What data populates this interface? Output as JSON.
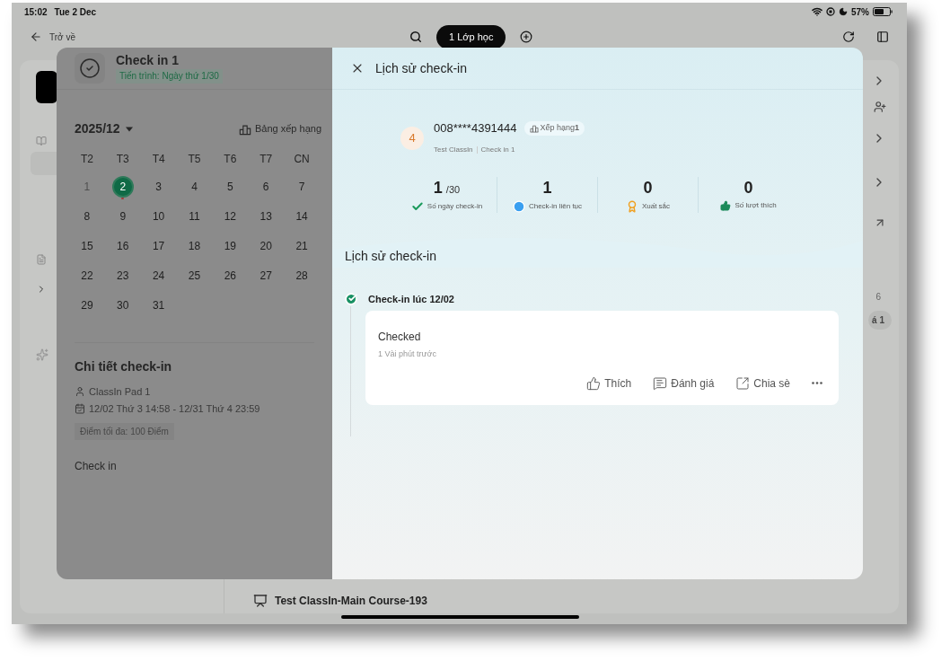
{
  "status_bar": {
    "time": "15:02",
    "date": "Tue 2 Dec",
    "battery": "57%"
  },
  "nav": {
    "back": "Trở về",
    "class_pill": "1 Lớp học"
  },
  "background": {
    "count": "6",
    "badge": "á 1",
    "course_title": "Test ClassIn-Main Course-193"
  },
  "checkin_panel": {
    "title": "Check in 1",
    "progress": "Tiến trình: Ngày thứ 1/30",
    "month": "2025/12",
    "ranking_link": "Bảng xếp hạng",
    "weekdays": [
      "T2",
      "T3",
      "T4",
      "T5",
      "T6",
      "T7",
      "CN"
    ],
    "days": [
      {
        "label": "1",
        "selected": false,
        "disabled": true,
        "marked": false
      },
      {
        "label": "2",
        "selected": true,
        "disabled": false,
        "marked": true
      },
      {
        "label": "3",
        "selected": false,
        "disabled": false,
        "marked": false
      },
      {
        "label": "4",
        "selected": false,
        "disabled": false,
        "marked": false
      },
      {
        "label": "5",
        "selected": false,
        "disabled": false,
        "marked": false
      },
      {
        "label": "6",
        "selected": false,
        "disabled": false,
        "marked": false
      },
      {
        "label": "7",
        "selected": false,
        "disabled": false,
        "marked": false
      },
      {
        "label": "8",
        "selected": false,
        "disabled": false,
        "marked": false
      },
      {
        "label": "9",
        "selected": false,
        "disabled": false,
        "marked": false
      },
      {
        "label": "10",
        "selected": false,
        "disabled": false,
        "marked": false
      },
      {
        "label": "11",
        "selected": false,
        "disabled": false,
        "marked": false
      },
      {
        "label": "12",
        "selected": false,
        "disabled": false,
        "marked": false
      },
      {
        "label": "13",
        "selected": false,
        "disabled": false,
        "marked": false
      },
      {
        "label": "14",
        "selected": false,
        "disabled": false,
        "marked": false
      },
      {
        "label": "15",
        "selected": false,
        "disabled": false,
        "marked": false
      },
      {
        "label": "16",
        "selected": false,
        "disabled": false,
        "marked": false
      },
      {
        "label": "17",
        "selected": false,
        "disabled": false,
        "marked": false
      },
      {
        "label": "18",
        "selected": false,
        "disabled": false,
        "marked": false
      },
      {
        "label": "19",
        "selected": false,
        "disabled": false,
        "marked": false
      },
      {
        "label": "20",
        "selected": false,
        "disabled": false,
        "marked": false
      },
      {
        "label": "21",
        "selected": false,
        "disabled": false,
        "marked": false
      },
      {
        "label": "22",
        "selected": false,
        "disabled": false,
        "marked": false
      },
      {
        "label": "23",
        "selected": false,
        "disabled": false,
        "marked": false
      },
      {
        "label": "24",
        "selected": false,
        "disabled": false,
        "marked": false
      },
      {
        "label": "25",
        "selected": false,
        "disabled": false,
        "marked": false
      },
      {
        "label": "26",
        "selected": false,
        "disabled": false,
        "marked": false
      },
      {
        "label": "27",
        "selected": false,
        "disabled": false,
        "marked": false
      },
      {
        "label": "28",
        "selected": false,
        "disabled": false,
        "marked": false
      },
      {
        "label": "29",
        "selected": false,
        "disabled": false,
        "marked": false
      },
      {
        "label": "30",
        "selected": false,
        "disabled": false,
        "marked": false
      },
      {
        "label": "31",
        "selected": false,
        "disabled": false,
        "marked": false
      }
    ],
    "details": {
      "heading": "Chi tiết check-in",
      "owner": "ClassIn Pad 1",
      "period": "12/02 Thứ 3 14:58 - 12/31 Thứ 4 23:59",
      "max_score": "Điểm tối đa: 100 Điểm",
      "description": "Check in"
    }
  },
  "history": {
    "title": "Lịch sử check-in",
    "user": {
      "avatar": "4",
      "name": "008****4391444",
      "rank": "Xếp hạng**1**",
      "class": "Test ClassIn",
      "activity": "Check in 1"
    },
    "stats": [
      {
        "kind": "days",
        "value": "1",
        "total": "/30",
        "label": "Số ngày check-in"
      },
      {
        "kind": "streak",
        "value": "1",
        "label": "Check-in liên tục"
      },
      {
        "kind": "excellent",
        "value": "0",
        "label": "Xuất sắc"
      },
      {
        "kind": "likes",
        "value": "0",
        "label": "Số lượt thích"
      }
    ],
    "section_title": "Lịch sử check-in",
    "entries": [
      {
        "time": "Check-in lúc 12/02",
        "text": "Checked",
        "meta": "1 Vài phút trước",
        "actions": [
          {
            "kind": "like",
            "label": "Thích"
          },
          {
            "kind": "comment",
            "label": "Đánh giá"
          },
          {
            "kind": "share",
            "label": "Chia sè"
          },
          {
            "kind": "more"
          }
        ]
      }
    ]
  }
}
